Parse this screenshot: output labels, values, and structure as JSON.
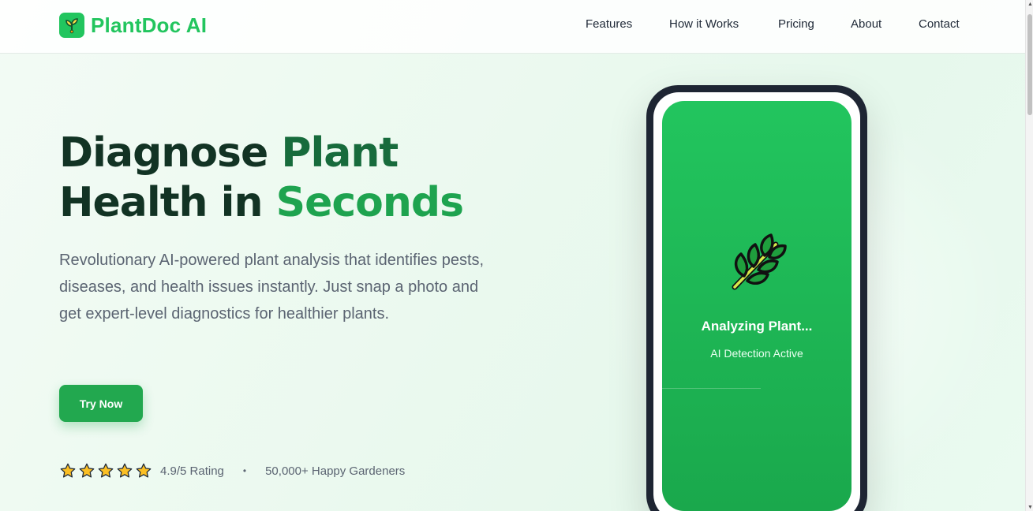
{
  "header": {
    "logo_text": "PlantDoc AI",
    "nav": [
      "Features",
      "How it Works",
      "Pricing",
      "About",
      "Contact"
    ]
  },
  "hero": {
    "headline_line1_dark": "Diagnose",
    "headline_line1_green": "Plant",
    "headline_line2_dark": "Health in",
    "headline_line2_green": "Seconds",
    "subtext": "Revolutionary AI-powered plant analysis that identifies pests, diseases, and health issues instantly. Just snap a photo and get expert-level diagnostics for healthier plants.",
    "cta_label": "Try Now",
    "stars_filled": 5,
    "rating_text": "4.9/5 Rating",
    "separator": "•",
    "users_text": "50,000+ Happy Gardeners"
  },
  "phone": {
    "status_title": "Analyzing Plant...",
    "status_subtitle": "AI Detection Active",
    "icon": "herb-leaf-icon"
  },
  "colors": {
    "brand": "#22c55e",
    "cta": "#22a84f",
    "headline_dark": "#123324",
    "headline_green": "#176b3c",
    "headline_green_bright": "#1ea34f",
    "phone_frame": "#1e2533"
  }
}
